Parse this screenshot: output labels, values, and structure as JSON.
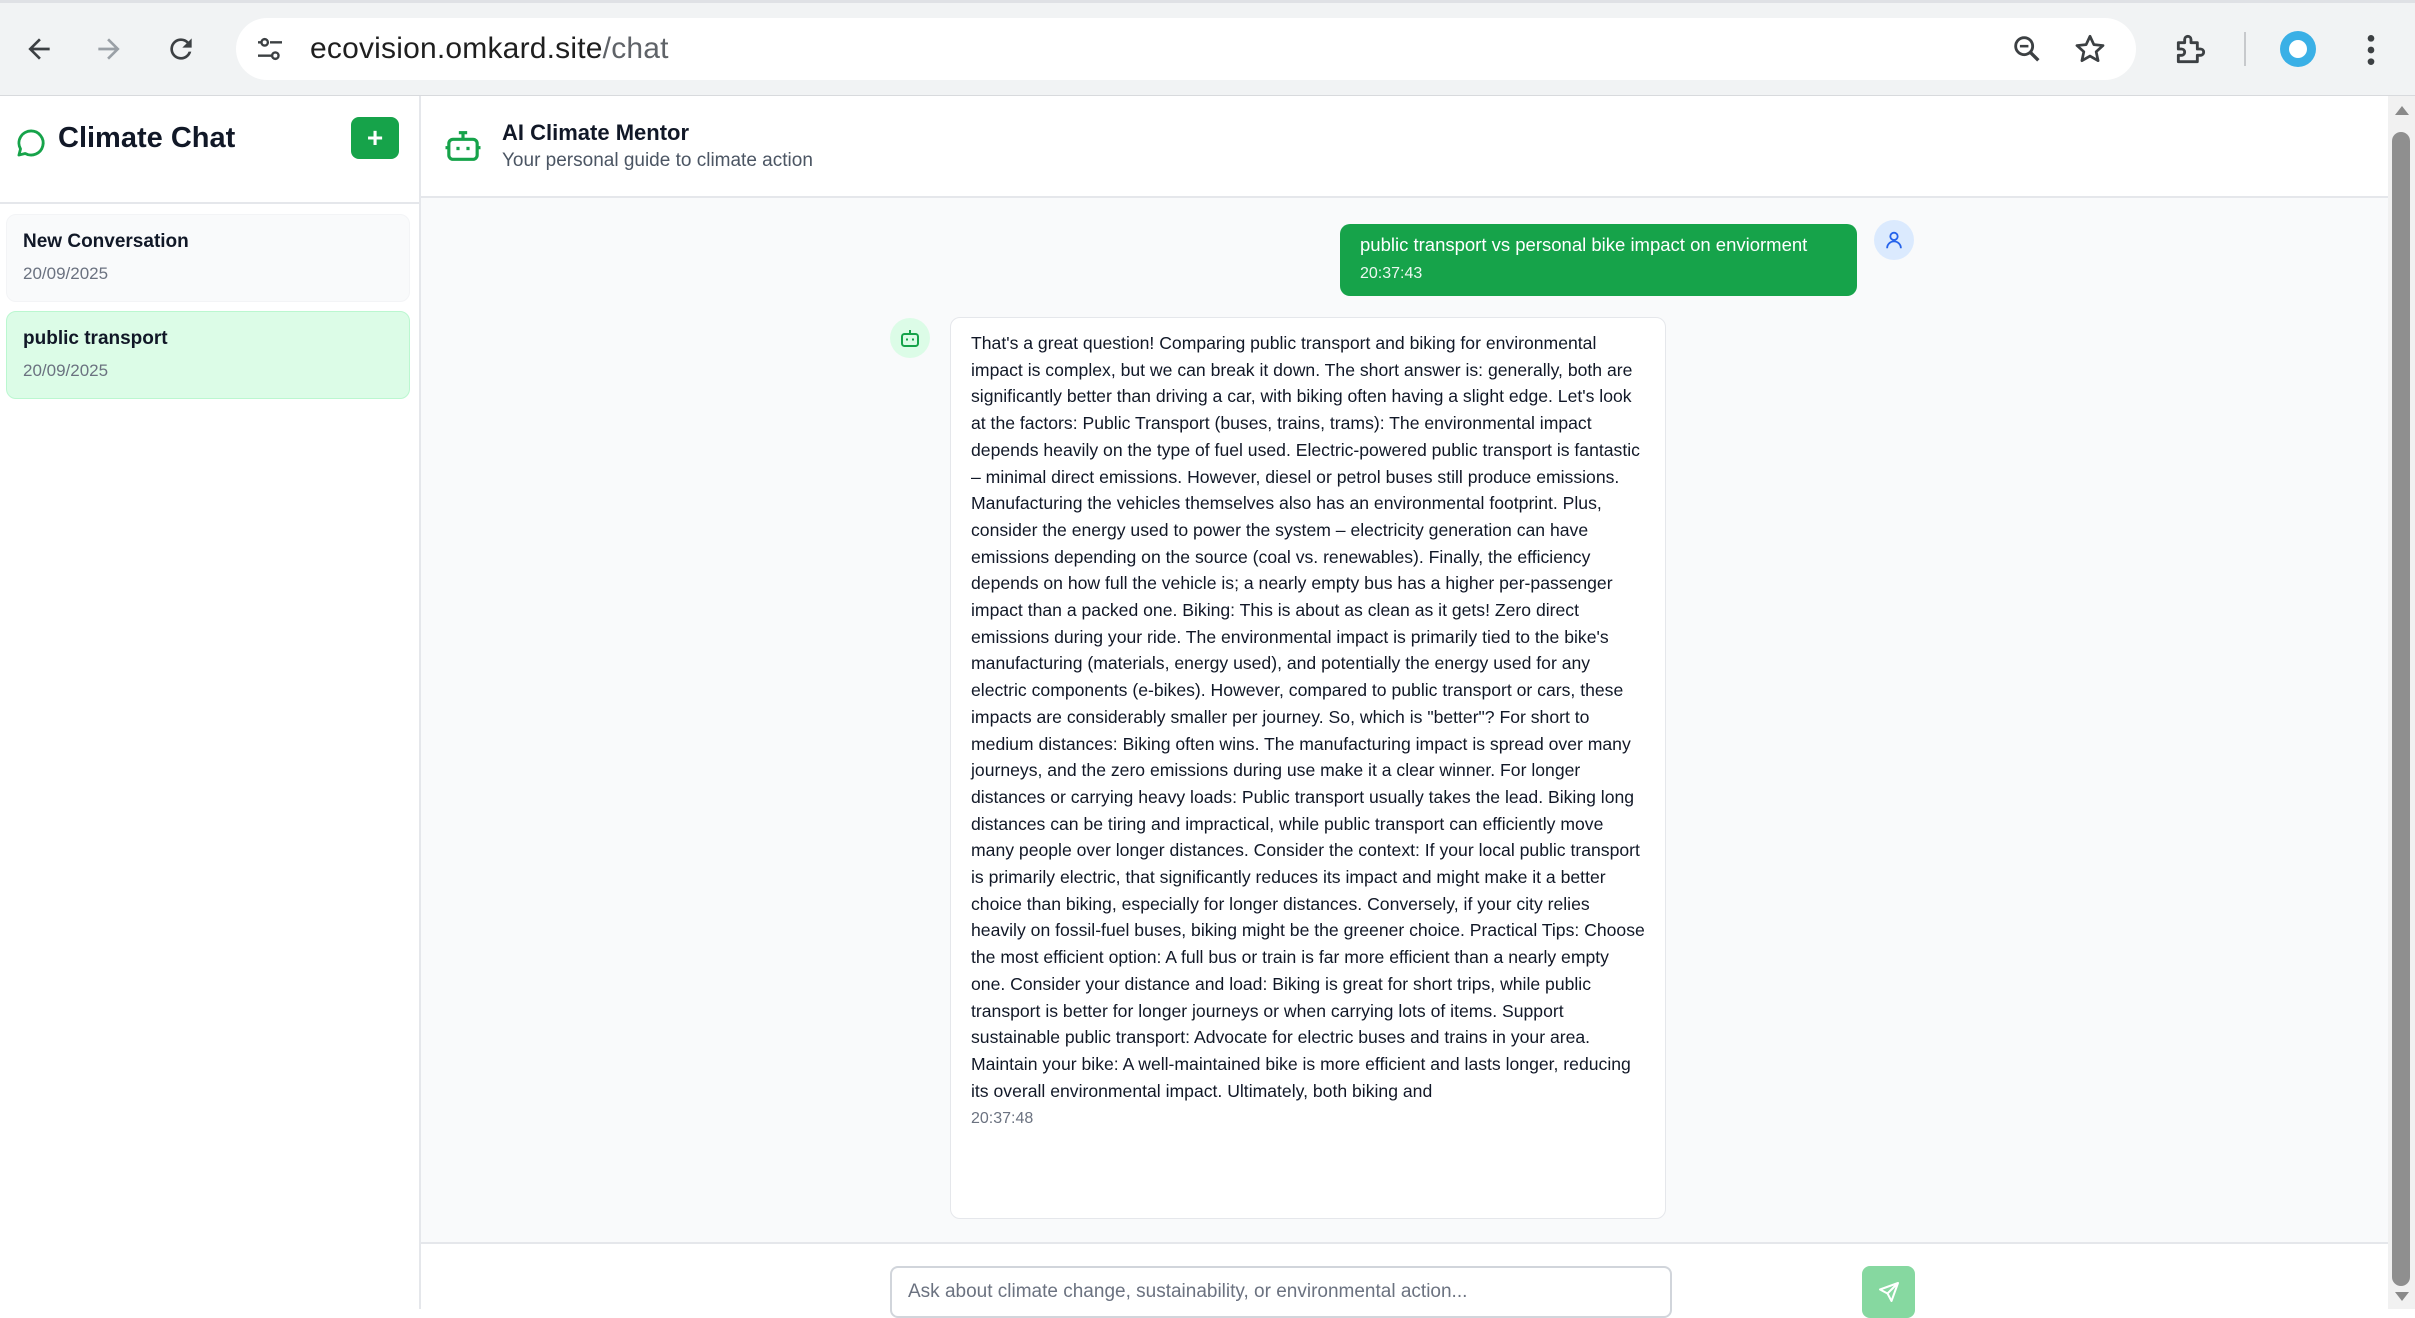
{
  "browser": {
    "url_host": "ecovision.omkard.site",
    "url_path": "/chat"
  },
  "sidebar": {
    "title": "Climate Chat",
    "new_button_label": "+",
    "conversations": [
      {
        "name": "New Conversation",
        "date": "20/09/2025",
        "active": false
      },
      {
        "name": "public transport",
        "date": "20/09/2025",
        "active": true
      }
    ]
  },
  "header": {
    "title": "AI Climate Mentor",
    "subtitle": "Your personal guide to climate action"
  },
  "messages": [
    {
      "role": "user",
      "text": "public transport vs personal bike impact on enviorment",
      "time": "20:37:43"
    },
    {
      "role": "assistant",
      "text": "That's a great question! Comparing public transport and biking for environmental impact is complex, but we can break it down. The short answer is: generally, both are significantly better than driving a car, with biking often having a slight edge. Let's look at the factors: Public Transport (buses, trains, trams): The environmental impact depends heavily on the type of fuel used. Electric-powered public transport is fantastic – minimal direct emissions. However, diesel or petrol buses still produce emissions. Manufacturing the vehicles themselves also has an environmental footprint. Plus, consider the energy used to power the system – electricity generation can have emissions depending on the source (coal vs. renewables). Finally, the efficiency depends on how full the vehicle is; a nearly empty bus has a higher per-passenger impact than a packed one. Biking: This is about as clean as it gets! Zero direct emissions during your ride. The environmental impact is primarily tied to the bike's manufacturing (materials, energy used), and potentially the energy used for any electric components (e-bikes). However, compared to public transport or cars, these impacts are considerably smaller per journey. So, which is \"better\"? For short to medium distances: Biking often wins. The manufacturing impact is spread over many journeys, and the zero emissions during use make it a clear winner. For longer distances or carrying heavy loads: Public transport usually takes the lead. Biking long distances can be tiring and impractical, while public transport can efficiently move many people over longer distances. Consider the context: If your local public transport is primarily electric, that significantly reduces its impact and might make it a better choice than biking, especially for longer distances. Conversely, if your city relies heavily on fossil-fuel buses, biking might be the greener choice. Practical Tips: Choose the most efficient option: A full bus or train is far more efficient than a nearly empty one. Consider your distance and load: Biking is great for short trips, while public transport is better for longer journeys or when carrying lots of items. Support sustainable public transport: Advocate for electric buses and trains in your area. Maintain your bike: A well-maintained bike is more efficient and lasts longer, reducing its overall environmental impact. Ultimately, both biking and",
      "time": "20:37:48"
    }
  ],
  "input": {
    "placeholder": "Ask about climate change, sustainability, or environmental action...",
    "value": ""
  },
  "icons": {
    "back": "arrow-left-icon",
    "forward": "arrow-right-icon",
    "reload": "reload-icon",
    "site_settings": "tune-icon",
    "zoom": "zoom-icon",
    "bookmark": "star-icon",
    "extensions": "puzzle-icon",
    "menu": "kebab-icon",
    "chat": "chat-bubble-icon",
    "bot": "bot-icon",
    "user": "user-icon",
    "send": "send-icon"
  },
  "colors": {
    "accent": "#16a34a",
    "active_item_bg": "#dcfce7",
    "send_disabled": "#86d8a0",
    "user_avatar_bg": "#dbeafe"
  }
}
